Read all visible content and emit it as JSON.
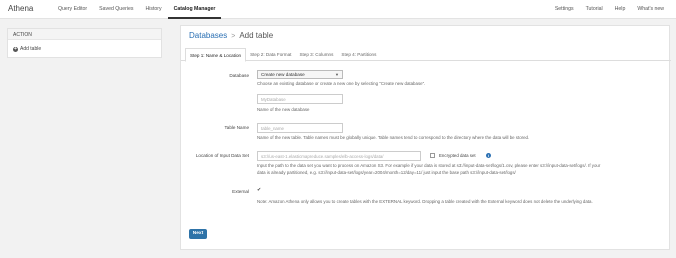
{
  "navbar": {
    "brand": "Athena",
    "left_items": [
      "Query Editor",
      "Saved Queries",
      "History",
      "Catalog Manager"
    ],
    "active_item": "Catalog Manager",
    "right_items": [
      "Settings",
      "Tutorial",
      "Help",
      "What's new"
    ]
  },
  "sidebar": {
    "header": "ACTION",
    "add_table": "Add table"
  },
  "breadcrumb": {
    "databases": "Databases",
    "separator": ">",
    "current": "Add table"
  },
  "tabs": [
    "Step 1: Name & Location",
    "Step 2: Data Format",
    "Step 3: Columns",
    "Step 4: Partitions"
  ],
  "form": {
    "database_label": "Database",
    "database_value": "Create new database",
    "database_help": "Choose an existing database or create a new one by selecting \"Create new database\".",
    "new_db_placeholder": "MyDatabase",
    "new_db_help": "Name of the new database",
    "table_label": "Table Name",
    "table_placeholder": "table_name",
    "table_help": "Name of the new table. Table names must be globally unique. Table names tend to correspond to the directory where the data will be stored.",
    "location_label": "Location of Input Data Set",
    "location_placeholder": "s3://us-east-1.elasticmapreduce.samples/elb-access-logs/data/",
    "encrypted_label": "Encrypted data set",
    "location_help1": "Input the path to the data set you want to process on Amazon S3. For example if your data is stored at s3://input-data-set/logs/1.csv, please enter s3://input-data-set/logs/. If your",
    "location_help2": "data is already partitioned, e.g. s3://input-data-set/logs/year=2004/month=12/day=11/ just input the base path s3://input-data-set/logs/",
    "external_label": "External",
    "external_note": "Note: Amazon Athena only allows you to create tables with the EXTERNAL keyword. Dropping a table created with the External keyword does not delete the underlying data.",
    "next_button": "Next"
  }
}
